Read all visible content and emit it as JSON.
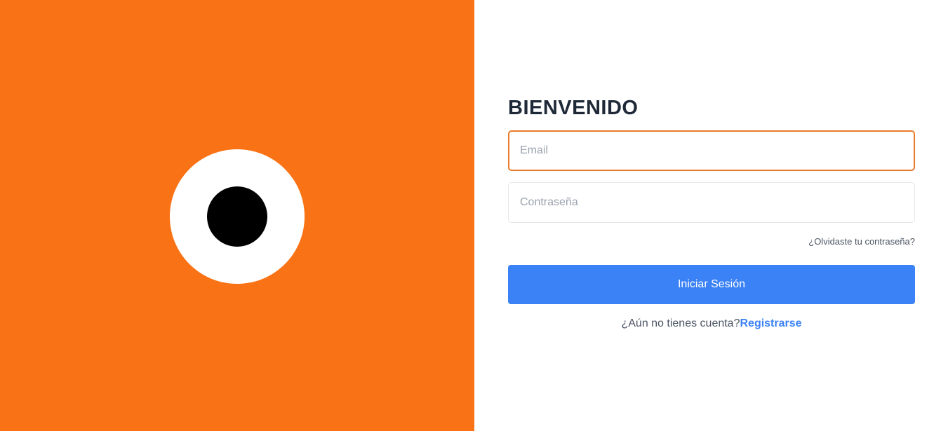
{
  "brand": {
    "panel_color": "#f97316",
    "logo_outer_color": "#ffffff",
    "logo_inner_color": "#000000"
  },
  "login": {
    "title": "BIENVENIDO",
    "email_placeholder": "Email",
    "email_value": "",
    "password_placeholder": "Contraseña",
    "password_value": "",
    "forgot_password": "¿Olvidaste tu contraseña?",
    "submit_label": "Iniciar Sesión",
    "signup_prompt": "¿Aún no tienes cuenta?",
    "signup_link": "Registrarse"
  },
  "colors": {
    "accent": "#3b82f6",
    "focus_border": "#ea7a2c",
    "title": "#1f2937"
  }
}
